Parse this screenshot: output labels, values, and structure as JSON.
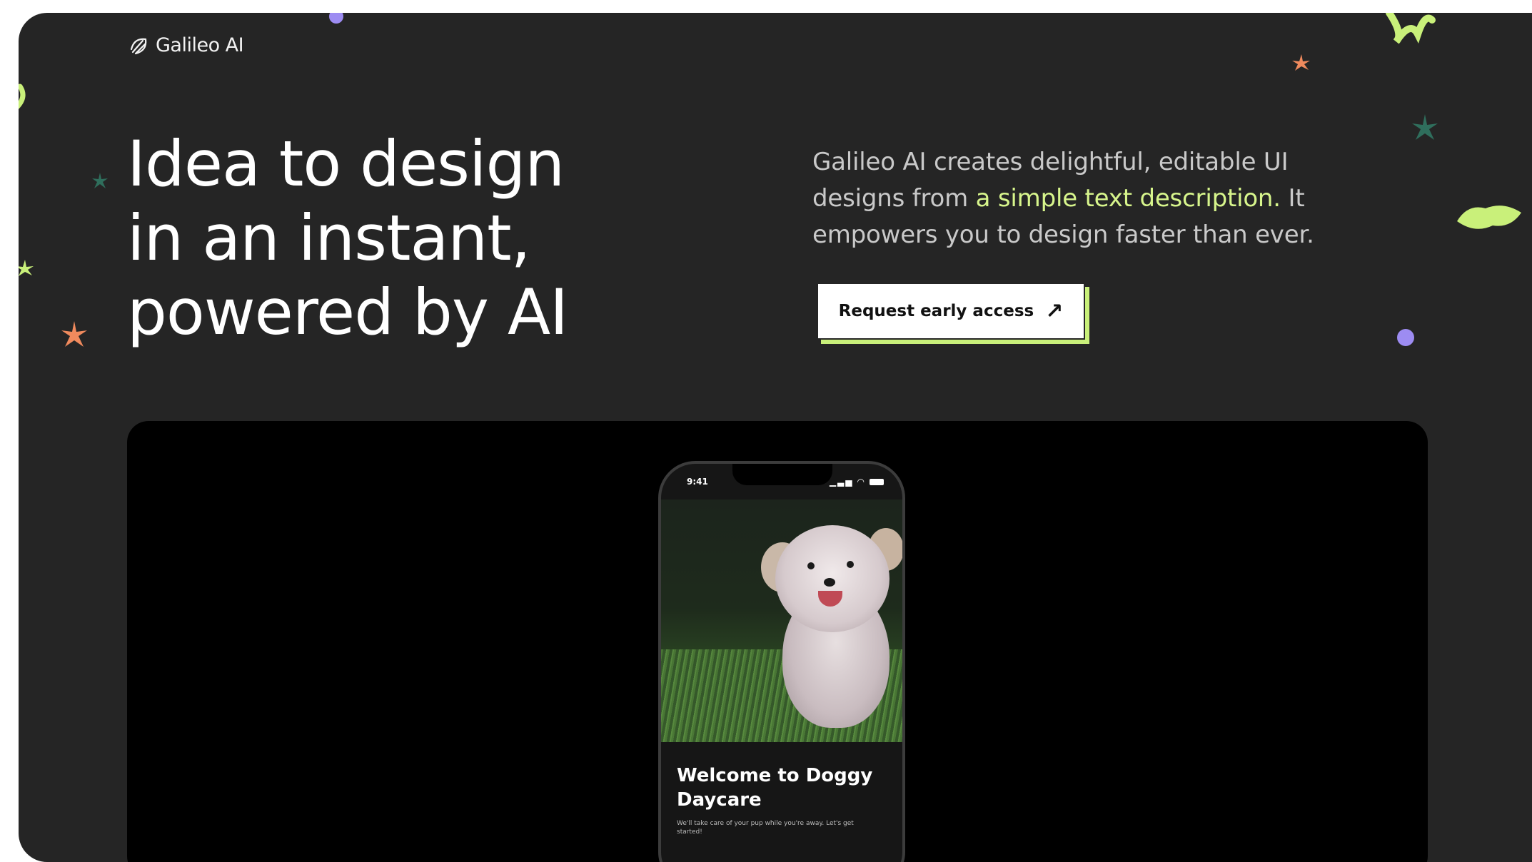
{
  "brand": {
    "name": "Galileo AI"
  },
  "hero": {
    "title_lines": [
      "Idea to design",
      "in an instant,",
      "powered by AI"
    ]
  },
  "description": {
    "part1": "Galileo AI creates delightful, editable UI designs from ",
    "highlight": "a simple text description.",
    "part2": " It empowers you to design faster than ever."
  },
  "cta": {
    "label": "Request early access",
    "arrow": "↗"
  },
  "phone": {
    "time": "9:41",
    "card_title": "Welcome to Doggy Daycare",
    "card_subtitle": "We'll take care of your pup while you're away. Let's get started!"
  },
  "colors": {
    "background": "#252525",
    "accent_green": "#d7f58c",
    "cta_shadow": "#c9f07a",
    "accent_orange": "#f08a5d",
    "accent_purple": "#9d8cf2",
    "accent_teal": "#2f6e5c"
  }
}
